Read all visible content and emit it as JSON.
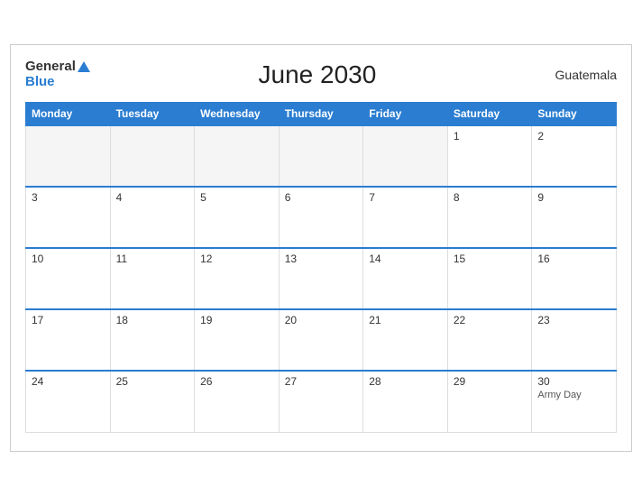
{
  "header": {
    "title": "June 2030",
    "country": "Guatemala"
  },
  "logo": {
    "general": "General",
    "blue": "Blue"
  },
  "weekdays": [
    "Monday",
    "Tuesday",
    "Wednesday",
    "Thursday",
    "Friday",
    "Saturday",
    "Sunday"
  ],
  "weeks": [
    [
      {
        "day": "",
        "empty": true
      },
      {
        "day": "",
        "empty": true
      },
      {
        "day": "",
        "empty": true
      },
      {
        "day": "",
        "empty": true
      },
      {
        "day": "",
        "empty": true
      },
      {
        "day": "1",
        "empty": false,
        "event": ""
      },
      {
        "day": "2",
        "empty": false,
        "event": ""
      }
    ],
    [
      {
        "day": "3",
        "empty": false,
        "event": ""
      },
      {
        "day": "4",
        "empty": false,
        "event": ""
      },
      {
        "day": "5",
        "empty": false,
        "event": ""
      },
      {
        "day": "6",
        "empty": false,
        "event": ""
      },
      {
        "day": "7",
        "empty": false,
        "event": ""
      },
      {
        "day": "8",
        "empty": false,
        "event": ""
      },
      {
        "day": "9",
        "empty": false,
        "event": ""
      }
    ],
    [
      {
        "day": "10",
        "empty": false,
        "event": ""
      },
      {
        "day": "11",
        "empty": false,
        "event": ""
      },
      {
        "day": "12",
        "empty": false,
        "event": ""
      },
      {
        "day": "13",
        "empty": false,
        "event": ""
      },
      {
        "day": "14",
        "empty": false,
        "event": ""
      },
      {
        "day": "15",
        "empty": false,
        "event": ""
      },
      {
        "day": "16",
        "empty": false,
        "event": ""
      }
    ],
    [
      {
        "day": "17",
        "empty": false,
        "event": ""
      },
      {
        "day": "18",
        "empty": false,
        "event": ""
      },
      {
        "day": "19",
        "empty": false,
        "event": ""
      },
      {
        "day": "20",
        "empty": false,
        "event": ""
      },
      {
        "day": "21",
        "empty": false,
        "event": ""
      },
      {
        "day": "22",
        "empty": false,
        "event": ""
      },
      {
        "day": "23",
        "empty": false,
        "event": ""
      }
    ],
    [
      {
        "day": "24",
        "empty": false,
        "event": ""
      },
      {
        "day": "25",
        "empty": false,
        "event": ""
      },
      {
        "day": "26",
        "empty": false,
        "event": ""
      },
      {
        "day": "27",
        "empty": false,
        "event": ""
      },
      {
        "day": "28",
        "empty": false,
        "event": ""
      },
      {
        "day": "29",
        "empty": false,
        "event": ""
      },
      {
        "day": "30",
        "empty": false,
        "event": "Army Day"
      }
    ]
  ]
}
